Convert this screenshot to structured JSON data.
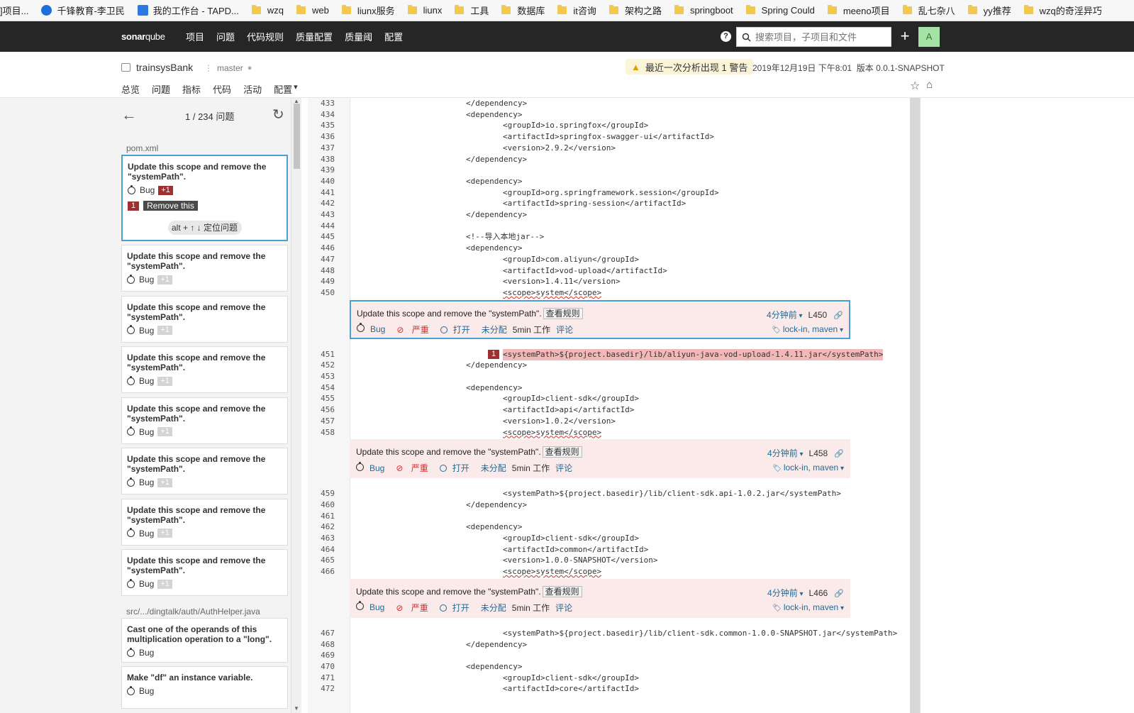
{
  "bookmarks": [
    {
      "label": "]项目...",
      "type": "text"
    },
    {
      "label": "千锋教育-李卫民",
      "type": "edge",
      "color": "#1e6fd9"
    },
    {
      "label": "我的工作台 - TAPD...",
      "type": "tapd",
      "color": "#2a7ae2"
    },
    {
      "label": "wzq",
      "type": "folder"
    },
    {
      "label": "web",
      "type": "folder"
    },
    {
      "label": "liunx服务",
      "type": "folder"
    },
    {
      "label": "liunx",
      "type": "folder"
    },
    {
      "label": "工具",
      "type": "folder"
    },
    {
      "label": "数据库",
      "type": "folder"
    },
    {
      "label": "it咨询",
      "type": "folder"
    },
    {
      "label": "架构之路",
      "type": "folder"
    },
    {
      "label": "springboot",
      "type": "folder"
    },
    {
      "label": "Spring Could",
      "type": "folder"
    },
    {
      "label": "meeno项目",
      "type": "folder"
    },
    {
      "label": "乱七杂八",
      "type": "folder"
    },
    {
      "label": "yy推荐",
      "type": "folder"
    },
    {
      "label": "wzq的奇淫异巧",
      "type": "folder"
    }
  ],
  "nav": {
    "logo_a": "sonar",
    "logo_b": "qube",
    "links": [
      "项目",
      "问题",
      "代码规则",
      "质量配置",
      "质量阈",
      "配置"
    ],
    "search_placeholder": "搜索项目，子项目和文件",
    "avatar": "A"
  },
  "project": {
    "name": "trainsysBank",
    "branch": "master",
    "warning": "最近一次分析出现 1 警告",
    "date": "2019年12月19日 下午8:01",
    "version": "版本 0.0.1-SNAPSHOT",
    "tabs": [
      "总览",
      "问题",
      "指标",
      "代码",
      "活动",
      "配置"
    ],
    "active_tab": "问题"
  },
  "sidebar": {
    "count": "1 / 234 问题",
    "file1": "pom.xml",
    "file2": "src/.../dingtalk/auth/AuthHelper.java",
    "selected_card": {
      "title": "Update this scope and remove the \"systemPath\".",
      "type": "Bug",
      "badge": "+1",
      "loc_num": "1",
      "loc_msg": "Remove this",
      "hint": "alt + ↑ ↓ 定位问题"
    },
    "cards": [
      {
        "title": "Update this scope and remove the \"systemPath\".",
        "type": "Bug",
        "badge": "+1"
      },
      {
        "title": "Update this scope and remove the \"systemPath\".",
        "type": "Bug",
        "badge": "+1"
      },
      {
        "title": "Update this scope and remove the \"systemPath\".",
        "type": "Bug",
        "badge": "+1"
      },
      {
        "title": "Update this scope and remove the \"systemPath\".",
        "type": "Bug",
        "badge": "+1"
      },
      {
        "title": "Update this scope and remove the \"systemPath\".",
        "type": "Bug",
        "badge": "+1"
      },
      {
        "title": "Update this scope and remove the \"systemPath\".",
        "type": "Bug",
        "badge": "+1"
      },
      {
        "title": "Update this scope and remove the \"systemPath\".",
        "type": "Bug",
        "badge": "+1"
      }
    ],
    "cards2": [
      {
        "title": "Cast one of the operands of this multiplication operation to a \"long\".",
        "type": "Bug"
      },
      {
        "title": "Make \"df\" an instance variable.",
        "type": "Bug"
      }
    ]
  },
  "code": {
    "lines": [
      {
        "n": "433",
        "t": "</dependency>",
        "i": 0
      },
      {
        "n": "434",
        "t": "<dependency>",
        "i": 0
      },
      {
        "n": "435",
        "t": "<groupId>io.springfox</groupId>",
        "i": 1
      },
      {
        "n": "436",
        "t": "<artifactId>springfox-swagger-ui</artifactId>",
        "i": 1
      },
      {
        "n": "437",
        "t": "<version>2.9.2</version>",
        "i": 1
      },
      {
        "n": "438",
        "t": "</dependency>",
        "i": 0
      },
      {
        "n": "439",
        "t": "",
        "i": 0
      },
      {
        "n": "440",
        "t": "<dependency>",
        "i": 0
      },
      {
        "n": "441",
        "t": "<groupId>org.springframework.session</groupId>",
        "i": 1
      },
      {
        "n": "442",
        "t": "<artifactId>spring-session</artifactId>",
        "i": 1
      },
      {
        "n": "443",
        "t": "</dependency>",
        "i": 0
      },
      {
        "n": "444",
        "t": "",
        "i": 0
      },
      {
        "n": "445",
        "t": "<!--导入本地jar-->",
        "i": 0
      },
      {
        "n": "446",
        "t": "<dependency>",
        "i": 0
      },
      {
        "n": "447",
        "t": "<groupId>com.aliyun</groupId>",
        "i": 1
      },
      {
        "n": "448",
        "t": "<artifactId>vod-upload</artifactId>",
        "i": 1
      },
      {
        "n": "449",
        "t": "<version>1.4.11</version>",
        "i": 1
      },
      {
        "n": "450",
        "t": "<scope>system</scope>",
        "i": 1,
        "sq": true
      },
      {
        "issue": 0
      },
      {
        "n": "451",
        "t": "<systemPath>${project.basedir}/lib/aliyun-java-vod-upload-1.4.11.jar</systemPath>",
        "i": 1,
        "hl": true,
        "marker": "1"
      },
      {
        "n": "452",
        "t": "</dependency>",
        "i": 0
      },
      {
        "n": "453",
        "t": "",
        "i": 0
      },
      {
        "n": "454",
        "t": "<dependency>",
        "i": 0
      },
      {
        "n": "455",
        "t": "<groupId>client-sdk</groupId>",
        "i": 1
      },
      {
        "n": "456",
        "t": "<artifactId>api</artifactId>",
        "i": 1
      },
      {
        "n": "457",
        "t": "<version>1.0.2</version>",
        "i": 1
      },
      {
        "n": "458",
        "t": "<scope>system</scope>",
        "i": 1,
        "sq": true
      },
      {
        "issue": 1
      },
      {
        "n": "459",
        "t": "<systemPath>${project.basedir}/lib/client-sdk.api-1.0.2.jar</systemPath>",
        "i": 1
      },
      {
        "n": "460",
        "t": "</dependency>",
        "i": 0
      },
      {
        "n": "461",
        "t": "",
        "i": 0
      },
      {
        "n": "462",
        "t": "<dependency>",
        "i": 0
      },
      {
        "n": "463",
        "t": "<groupId>client-sdk</groupId>",
        "i": 1
      },
      {
        "n": "464",
        "t": "<artifactId>common</artifactId>",
        "i": 1
      },
      {
        "n": "465",
        "t": "<version>1.0.0-SNAPSHOT</version>",
        "i": 1
      },
      {
        "n": "466",
        "t": "<scope>system</scope>",
        "i": 1,
        "sq": true
      },
      {
        "issue": 2
      },
      {
        "n": "467",
        "t": "<systemPath>${project.basedir}/lib/client-sdk.common-1.0.0-SNAPSHOT.jar</systemPath>",
        "i": 1
      },
      {
        "n": "468",
        "t": "</dependency>",
        "i": 0
      },
      {
        "n": "469",
        "t": "",
        "i": 0
      },
      {
        "n": "470",
        "t": "<dependency>",
        "i": 0
      },
      {
        "n": "471",
        "t": "<groupId>client-sdk</groupId>",
        "i": 1
      },
      {
        "n": "472",
        "t": "<artifactId>core</artifactId>",
        "i": 1
      }
    ],
    "issues": [
      {
        "msg": "Update this scope and remove the \"systemPath\".",
        "rule": "查看规则",
        "time": "4分钟前",
        "line": "L450",
        "type": "Bug",
        "severity": "严重",
        "status": "打开",
        "assignee": "未分配",
        "effort": "5min 工作",
        "comment": "评论",
        "tags": "lock-in, maven",
        "selected": true
      },
      {
        "msg": "Update this scope and remove the \"systemPath\".",
        "rule": "查看规则",
        "time": "4分钟前",
        "line": "L458",
        "type": "Bug",
        "severity": "严重",
        "status": "打开",
        "assignee": "未分配",
        "effort": "5min 工作",
        "comment": "评论",
        "tags": "lock-in, maven",
        "selected": false
      },
      {
        "msg": "Update this scope and remove the \"systemPath\".",
        "rule": "查看规则",
        "time": "4分钟前",
        "line": "L466",
        "type": "Bug",
        "severity": "严重",
        "status": "打开",
        "assignee": "未分配",
        "effort": "5min 工作",
        "comment": "评论",
        "tags": "lock-in, maven",
        "selected": false
      }
    ]
  }
}
